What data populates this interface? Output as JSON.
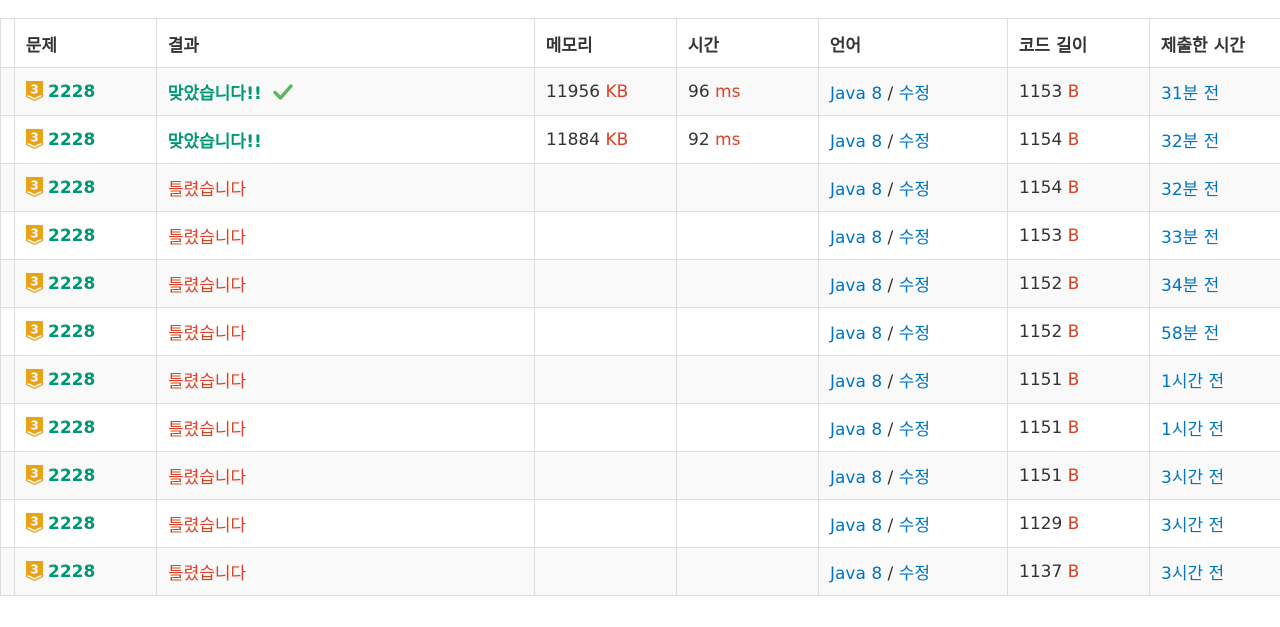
{
  "headers": [
    "문제",
    "결과",
    "메모리",
    "시간",
    "언어",
    "코드 길이",
    "제출한 시간"
  ],
  "colors": {
    "accepted": "#009874",
    "wrong": "#dd4124",
    "link": "#0076c0",
    "tier": "#e8a317"
  },
  "rows": [
    {
      "tier": "3",
      "problem": "2228",
      "result": "맞았습니다!!",
      "status": "accepted",
      "memory": "11956",
      "memory_unit": "KB",
      "time": "96",
      "time_unit": "ms",
      "language": "Java 8",
      "sep": "/",
      "edit": "수정",
      "code_length": "1153",
      "code_unit": "B",
      "submitted": "31분 전"
    },
    {
      "tier": "3",
      "problem": "2228",
      "result": "맞았습니다!!",
      "status": "accepted",
      "memory": "11884",
      "memory_unit": "KB",
      "time": "92",
      "time_unit": "ms",
      "language": "Java 8",
      "sep": "/",
      "edit": "수정",
      "code_length": "1154",
      "code_unit": "B",
      "submitted": "32분 전"
    },
    {
      "tier": "3",
      "problem": "2228",
      "result": "틀렸습니다",
      "status": "wrong",
      "memory": "",
      "memory_unit": "",
      "time": "",
      "time_unit": "",
      "language": "Java 8",
      "sep": "/",
      "edit": "수정",
      "code_length": "1154",
      "code_unit": "B",
      "submitted": "32분 전"
    },
    {
      "tier": "3",
      "problem": "2228",
      "result": "틀렸습니다",
      "status": "wrong",
      "memory": "",
      "memory_unit": "",
      "time": "",
      "time_unit": "",
      "language": "Java 8",
      "sep": "/",
      "edit": "수정",
      "code_length": "1153",
      "code_unit": "B",
      "submitted": "33분 전"
    },
    {
      "tier": "3",
      "problem": "2228",
      "result": "틀렸습니다",
      "status": "wrong",
      "memory": "",
      "memory_unit": "",
      "time": "",
      "time_unit": "",
      "language": "Java 8",
      "sep": "/",
      "edit": "수정",
      "code_length": "1152",
      "code_unit": "B",
      "submitted": "34분 전"
    },
    {
      "tier": "3",
      "problem": "2228",
      "result": "틀렸습니다",
      "status": "wrong",
      "memory": "",
      "memory_unit": "",
      "time": "",
      "time_unit": "",
      "language": "Java 8",
      "sep": "/",
      "edit": "수정",
      "code_length": "1152",
      "code_unit": "B",
      "submitted": "58분 전"
    },
    {
      "tier": "3",
      "problem": "2228",
      "result": "틀렸습니다",
      "status": "wrong",
      "memory": "",
      "memory_unit": "",
      "time": "",
      "time_unit": "",
      "language": "Java 8",
      "sep": "/",
      "edit": "수정",
      "code_length": "1151",
      "code_unit": "B",
      "submitted": "1시간 전"
    },
    {
      "tier": "3",
      "problem": "2228",
      "result": "틀렸습니다",
      "status": "wrong",
      "memory": "",
      "memory_unit": "",
      "time": "",
      "time_unit": "",
      "language": "Java 8",
      "sep": "/",
      "edit": "수정",
      "code_length": "1151",
      "code_unit": "B",
      "submitted": "1시간 전"
    },
    {
      "tier": "3",
      "problem": "2228",
      "result": "틀렸습니다",
      "status": "wrong",
      "memory": "",
      "memory_unit": "",
      "time": "",
      "time_unit": "",
      "language": "Java 8",
      "sep": "/",
      "edit": "수정",
      "code_length": "1151",
      "code_unit": "B",
      "submitted": "3시간 전"
    },
    {
      "tier": "3",
      "problem": "2228",
      "result": "틀렸습니다",
      "status": "wrong",
      "memory": "",
      "memory_unit": "",
      "time": "",
      "time_unit": "",
      "language": "Java 8",
      "sep": "/",
      "edit": "수정",
      "code_length": "1129",
      "code_unit": "B",
      "submitted": "3시간 전"
    },
    {
      "tier": "3",
      "problem": "2228",
      "result": "틀렸습니다",
      "status": "wrong",
      "memory": "",
      "memory_unit": "",
      "time": "",
      "time_unit": "",
      "language": "Java 8",
      "sep": "/",
      "edit": "수정",
      "code_length": "1137",
      "code_unit": "B",
      "submitted": "3시간 전"
    }
  ]
}
